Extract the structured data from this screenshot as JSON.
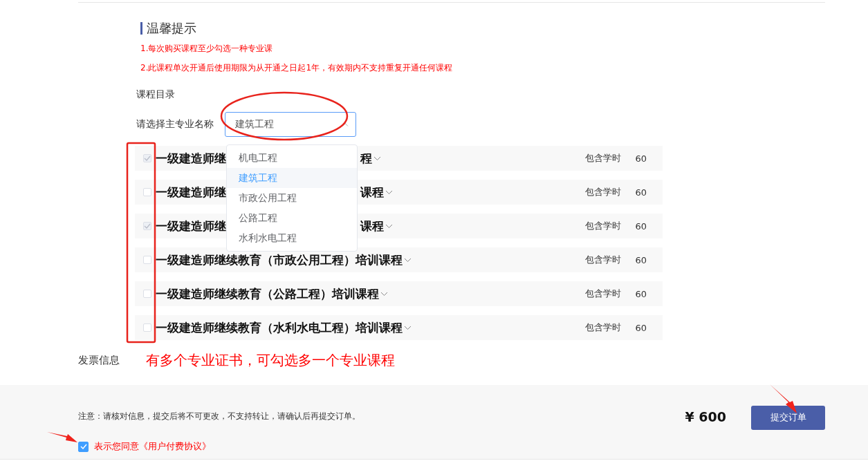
{
  "tips": {
    "title": "温馨提示",
    "items": [
      "1.每次购买课程至少勾选一种专业课",
      "2.此课程单次开通后使用期限为从开通之日起1年，有效期内不支持重复开通任何课程"
    ]
  },
  "catalog_label": "课程目录",
  "major_select": {
    "label": "请选择主专业名称",
    "value": "建筑工程",
    "expanded": true,
    "options": [
      {
        "label": "机电工程",
        "selected": false
      },
      {
        "label": "建筑工程",
        "selected": true
      },
      {
        "label": "市政公用工程",
        "selected": false
      },
      {
        "label": "公路工程",
        "selected": false
      },
      {
        "label": "水利水电工程",
        "selected": false
      }
    ]
  },
  "courses": [
    {
      "checked": true,
      "title_parts": [
        "一级建造师继",
        "程"
      ],
      "hours_label": "包含学时",
      "hours": "60"
    },
    {
      "checked": false,
      "title_parts": [
        "一级建造师继",
        "课程"
      ],
      "hours_label": "包含学时",
      "hours": "60"
    },
    {
      "checked": true,
      "title_parts": [
        "一级建造师继",
        "课程"
      ],
      "hours_label": "包含学时",
      "hours": "60"
    },
    {
      "checked": false,
      "title_parts": [
        "一级建造师继续教育（市政公用工程）培训课程"
      ],
      "hours_label": "包含学时",
      "hours": "60"
    },
    {
      "checked": false,
      "title_parts": [
        "一级建造师继续教育（公路工程）培训课程"
      ],
      "hours_label": "包含学时",
      "hours": "60"
    },
    {
      "checked": false,
      "title_parts": [
        "一级建造师继续教育（水利水电工程）培训课程"
      ],
      "hours_label": "包含学时",
      "hours": "60"
    }
  ],
  "invoice_label": "发票信息",
  "annotation_text": "有多个专业证书，可勾选多一个专业课程",
  "footer": {
    "notice": "注意：请核对信息，提交后将不可更改，不支持转让，请确认后再提交订单。",
    "agreement": {
      "checked": true,
      "text": "表示您同意《用户付费协议》"
    },
    "price": "¥ 600",
    "submit": "提交订单"
  }
}
